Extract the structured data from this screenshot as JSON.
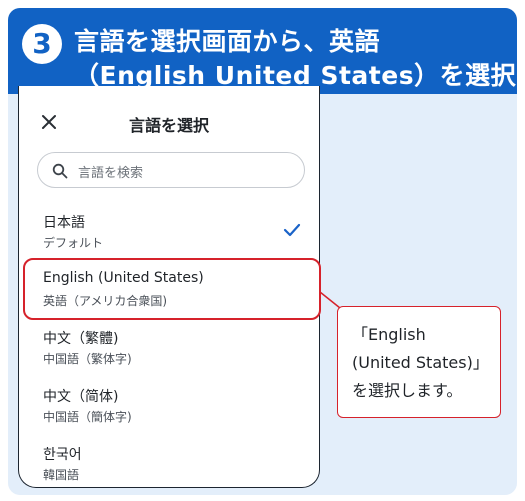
{
  "header": {
    "step_number": "3",
    "line1": "言語を選択画面から、英語",
    "line2": "（English United States）を選択する"
  },
  "dialog": {
    "title": "言語を選択",
    "search": {
      "placeholder": "言語を検索"
    },
    "languages": [
      {
        "name": "日本語",
        "sub": "デフォルト",
        "selected": true
      },
      {
        "name": "English (United States)",
        "sub": "英語（アメリカ合衆国)"
      },
      {
        "name": "中文（繁體)",
        "sub": "中国語（繁体字)"
      },
      {
        "name": "中文（简体)",
        "sub": "中国語（簡体字)"
      },
      {
        "name": "한국어",
        "sub": "韓国語"
      }
    ]
  },
  "callout": {
    "line1": "「English",
    "line2": "(United States)」",
    "line3": "を選択します。"
  },
  "colors": {
    "header_bg": "#1162c4",
    "frame_bg": "#e3eefa",
    "highlight": "#d6222b",
    "check": "#1a63c8"
  }
}
